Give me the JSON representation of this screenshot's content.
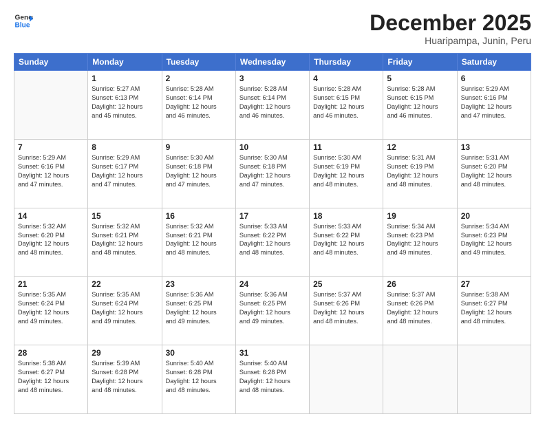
{
  "logo": {
    "general": "General",
    "blue": "Blue"
  },
  "header": {
    "month": "December 2025",
    "location": "Huaripampa, Junin, Peru"
  },
  "days_of_week": [
    "Sunday",
    "Monday",
    "Tuesday",
    "Wednesday",
    "Thursday",
    "Friday",
    "Saturday"
  ],
  "weeks": [
    [
      {
        "day": null,
        "info": null
      },
      {
        "day": "1",
        "info": "Sunrise: 5:27 AM\nSunset: 6:13 PM\nDaylight: 12 hours\nand 45 minutes."
      },
      {
        "day": "2",
        "info": "Sunrise: 5:28 AM\nSunset: 6:14 PM\nDaylight: 12 hours\nand 46 minutes."
      },
      {
        "day": "3",
        "info": "Sunrise: 5:28 AM\nSunset: 6:14 PM\nDaylight: 12 hours\nand 46 minutes."
      },
      {
        "day": "4",
        "info": "Sunrise: 5:28 AM\nSunset: 6:15 PM\nDaylight: 12 hours\nand 46 minutes."
      },
      {
        "day": "5",
        "info": "Sunrise: 5:28 AM\nSunset: 6:15 PM\nDaylight: 12 hours\nand 46 minutes."
      },
      {
        "day": "6",
        "info": "Sunrise: 5:29 AM\nSunset: 6:16 PM\nDaylight: 12 hours\nand 47 minutes."
      }
    ],
    [
      {
        "day": "7",
        "info": "Sunrise: 5:29 AM\nSunset: 6:16 PM\nDaylight: 12 hours\nand 47 minutes."
      },
      {
        "day": "8",
        "info": "Sunrise: 5:29 AM\nSunset: 6:17 PM\nDaylight: 12 hours\nand 47 minutes."
      },
      {
        "day": "9",
        "info": "Sunrise: 5:30 AM\nSunset: 6:18 PM\nDaylight: 12 hours\nand 47 minutes."
      },
      {
        "day": "10",
        "info": "Sunrise: 5:30 AM\nSunset: 6:18 PM\nDaylight: 12 hours\nand 47 minutes."
      },
      {
        "day": "11",
        "info": "Sunrise: 5:30 AM\nSunset: 6:19 PM\nDaylight: 12 hours\nand 48 minutes."
      },
      {
        "day": "12",
        "info": "Sunrise: 5:31 AM\nSunset: 6:19 PM\nDaylight: 12 hours\nand 48 minutes."
      },
      {
        "day": "13",
        "info": "Sunrise: 5:31 AM\nSunset: 6:20 PM\nDaylight: 12 hours\nand 48 minutes."
      }
    ],
    [
      {
        "day": "14",
        "info": "Sunrise: 5:32 AM\nSunset: 6:20 PM\nDaylight: 12 hours\nand 48 minutes."
      },
      {
        "day": "15",
        "info": "Sunrise: 5:32 AM\nSunset: 6:21 PM\nDaylight: 12 hours\nand 48 minutes."
      },
      {
        "day": "16",
        "info": "Sunrise: 5:32 AM\nSunset: 6:21 PM\nDaylight: 12 hours\nand 48 minutes."
      },
      {
        "day": "17",
        "info": "Sunrise: 5:33 AM\nSunset: 6:22 PM\nDaylight: 12 hours\nand 48 minutes."
      },
      {
        "day": "18",
        "info": "Sunrise: 5:33 AM\nSunset: 6:22 PM\nDaylight: 12 hours\nand 48 minutes."
      },
      {
        "day": "19",
        "info": "Sunrise: 5:34 AM\nSunset: 6:23 PM\nDaylight: 12 hours\nand 49 minutes."
      },
      {
        "day": "20",
        "info": "Sunrise: 5:34 AM\nSunset: 6:23 PM\nDaylight: 12 hours\nand 49 minutes."
      }
    ],
    [
      {
        "day": "21",
        "info": "Sunrise: 5:35 AM\nSunset: 6:24 PM\nDaylight: 12 hours\nand 49 minutes."
      },
      {
        "day": "22",
        "info": "Sunrise: 5:35 AM\nSunset: 6:24 PM\nDaylight: 12 hours\nand 49 minutes."
      },
      {
        "day": "23",
        "info": "Sunrise: 5:36 AM\nSunset: 6:25 PM\nDaylight: 12 hours\nand 49 minutes."
      },
      {
        "day": "24",
        "info": "Sunrise: 5:36 AM\nSunset: 6:25 PM\nDaylight: 12 hours\nand 49 minutes."
      },
      {
        "day": "25",
        "info": "Sunrise: 5:37 AM\nSunset: 6:26 PM\nDaylight: 12 hours\nand 48 minutes."
      },
      {
        "day": "26",
        "info": "Sunrise: 5:37 AM\nSunset: 6:26 PM\nDaylight: 12 hours\nand 48 minutes."
      },
      {
        "day": "27",
        "info": "Sunrise: 5:38 AM\nSunset: 6:27 PM\nDaylight: 12 hours\nand 48 minutes."
      }
    ],
    [
      {
        "day": "28",
        "info": "Sunrise: 5:38 AM\nSunset: 6:27 PM\nDaylight: 12 hours\nand 48 minutes."
      },
      {
        "day": "29",
        "info": "Sunrise: 5:39 AM\nSunset: 6:28 PM\nDaylight: 12 hours\nand 48 minutes."
      },
      {
        "day": "30",
        "info": "Sunrise: 5:40 AM\nSunset: 6:28 PM\nDaylight: 12 hours\nand 48 minutes."
      },
      {
        "day": "31",
        "info": "Sunrise: 5:40 AM\nSunset: 6:28 PM\nDaylight: 12 hours\nand 48 minutes."
      },
      {
        "day": null,
        "info": null
      },
      {
        "day": null,
        "info": null
      },
      {
        "day": null,
        "info": null
      }
    ]
  ]
}
